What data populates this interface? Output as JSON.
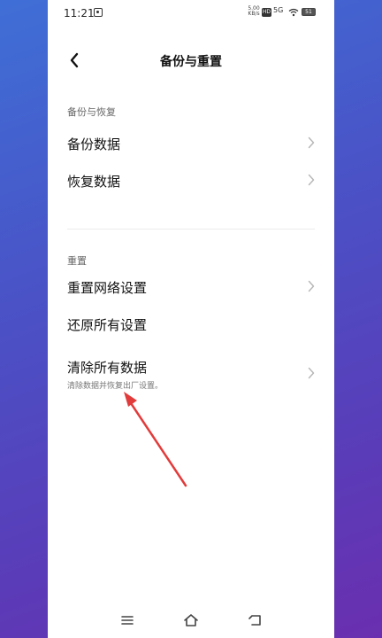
{
  "status": {
    "time": "11:21",
    "speed": "5.00 KB/s",
    "sim1": "HD",
    "net": "5G",
    "sim2": "HD",
    "battery": "51"
  },
  "header": {
    "title": "备份与重置"
  },
  "sections": [
    {
      "label": "备份与恢复",
      "items": [
        {
          "label": "备份数据"
        },
        {
          "label": "恢复数据"
        }
      ]
    },
    {
      "label": "重置",
      "items": [
        {
          "label": "重置网络设置"
        },
        {
          "label": "还原所有设置"
        },
        {
          "label": "清除所有数据",
          "subtitle": "清除数据并恢复出厂设置。"
        }
      ]
    }
  ],
  "colors": {
    "accent_arrow": "#e23b3b",
    "text": "#111111",
    "secondary": "#666666"
  },
  "icons": {
    "back": "chevron-left-icon",
    "chevron": "chevron-right-icon",
    "menu": "menu-icon",
    "home": "home-icon",
    "return": "return-icon"
  }
}
